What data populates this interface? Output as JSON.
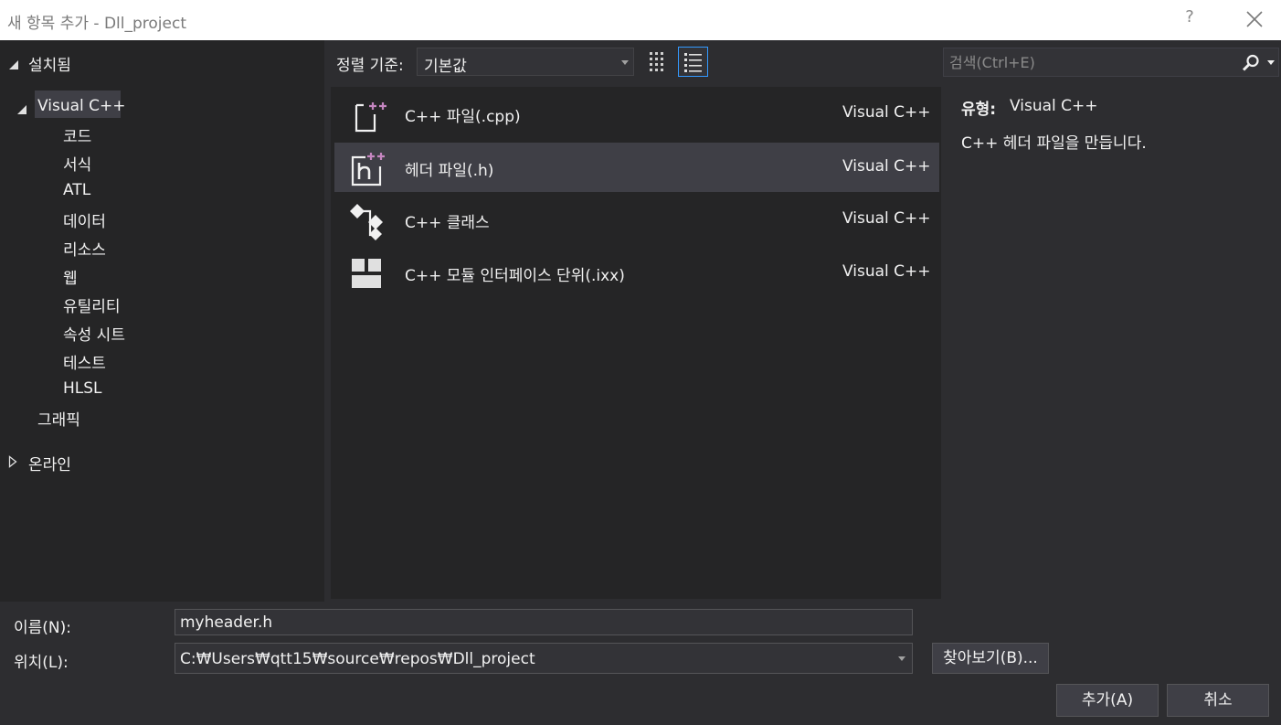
{
  "window": {
    "title": "새 항목 추가 - Dll_project",
    "help": "?"
  },
  "left_tree": {
    "installed": "설치됨",
    "visual_cpp": "Visual C++",
    "children": [
      "코드",
      "서식",
      "ATL",
      "데이터",
      "리소스",
      "웹",
      "유틸리티",
      "속성 시트",
      "테스트",
      "HLSL"
    ],
    "graphics": "그래픽",
    "online": "온라인"
  },
  "toolbar": {
    "sort_label": "정렬 기준:",
    "sort_value": "기본값"
  },
  "search": {
    "placeholder": "검색(Ctrl+E)"
  },
  "templates": [
    {
      "name": "C++ 파일(.cpp)",
      "lang": "Visual C++",
      "icon": "cpp-file-icon",
      "selected": false
    },
    {
      "name": "헤더 파일(.h)",
      "lang": "Visual C++",
      "icon": "header-file-icon",
      "selected": true
    },
    {
      "name": "C++ 클래스",
      "lang": "Visual C++",
      "icon": "class-icon",
      "selected": false
    },
    {
      "name": "C++ 모듈 인터페이스 단위(.ixx)",
      "lang": "Visual C++",
      "icon": "module-icon",
      "selected": false
    }
  ],
  "details": {
    "type_label": "유형:",
    "type_value": "Visual C++",
    "description": "C++ 헤더 파일을 만듭니다."
  },
  "form": {
    "name_label": "이름(N):",
    "name_value": "myheader.h",
    "location_label": "위치(L):",
    "location_value": "C:₩Users₩qtt15₩source₩repos₩Dll_project",
    "browse_label": "찾아보기(B)...",
    "add_label": "추가(A)",
    "cancel_label": "취소"
  },
  "colors": {
    "accent": "#3399ff",
    "plus": "#c586c0",
    "bg": "#2d2d30",
    "panel": "#252526",
    "selection": "#3f3f46"
  }
}
